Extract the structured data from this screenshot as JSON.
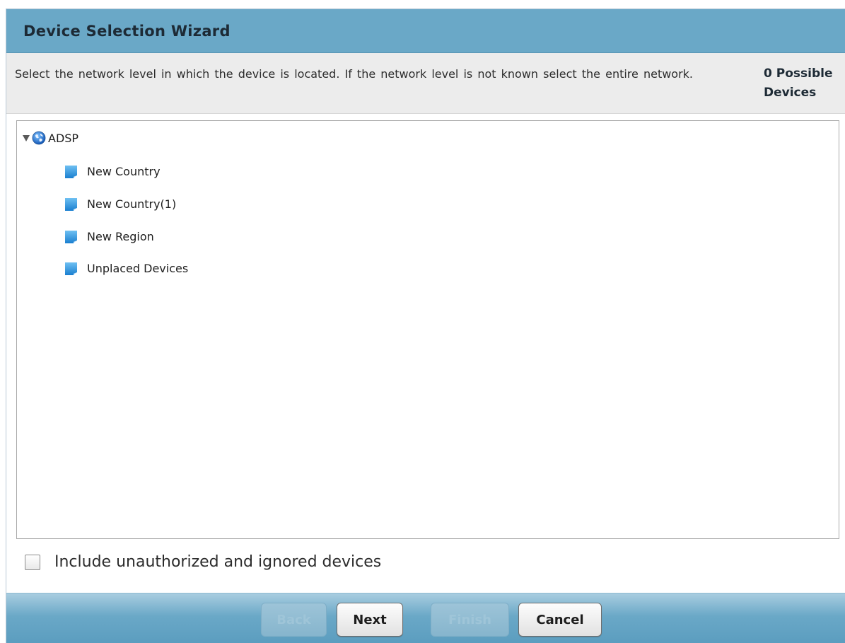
{
  "dialog": {
    "title": "Device Selection Wizard",
    "instructions": "Select the network level in which the device is located. If the network level is not known select the entire network.",
    "possible_devices": "0 Possible Devices"
  },
  "tree": {
    "root": {
      "label": "ADSP",
      "icon": "globe-icon",
      "expanded": true
    },
    "children": [
      {
        "label": "New Country",
        "icon": "folder-icon"
      },
      {
        "label": "New Country(1)",
        "icon": "folder-icon"
      },
      {
        "label": "New Region",
        "icon": "folder-icon"
      },
      {
        "label": "Unplaced Devices",
        "icon": "folder-icon"
      }
    ]
  },
  "options": {
    "include_unauthorized_label": "Include unauthorized and ignored devices",
    "include_unauthorized_checked": false
  },
  "buttons": {
    "back": {
      "label": "Back",
      "enabled": false
    },
    "next": {
      "label": "Next",
      "enabled": true
    },
    "finish": {
      "label": "Finish",
      "enabled": false
    },
    "cancel": {
      "label": "Cancel",
      "enabled": true
    }
  },
  "colors": {
    "title_bar": "#6aa8c7",
    "instructions_bg": "#ececec",
    "button_bar": "#6aa8c7"
  }
}
